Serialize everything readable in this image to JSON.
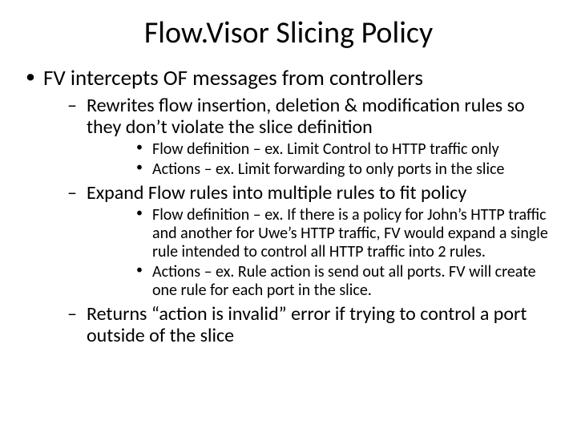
{
  "title": "Flow.Visor Slicing Policy",
  "bullets": {
    "l1_0": "FV intercepts OF messages from controllers",
    "l2_0": "Rewrites flow insertion, deletion & modification rules so they don’t violate the slice definition",
    "l3_0": "Flow definition – ex. Limit Control to HTTP traffic only",
    "l3_1": "Actions – ex. Limit forwarding to only ports in the slice",
    "l2_1": "Expand Flow rules into multiple rules to fit policy",
    "l3_2": "Flow definition – ex. If there is a policy for John’s HTTP traffic and another for Uwe’s HTTP traffic, FV would expand a single rule intended to control all HTTP traffic into 2 rules.",
    "l3_3": "Actions – ex. Rule action is send out all ports. FV will create one rule for each port in the slice.",
    "l2_2": "Returns “action is invalid” error if trying to control a port outside of the slice"
  }
}
